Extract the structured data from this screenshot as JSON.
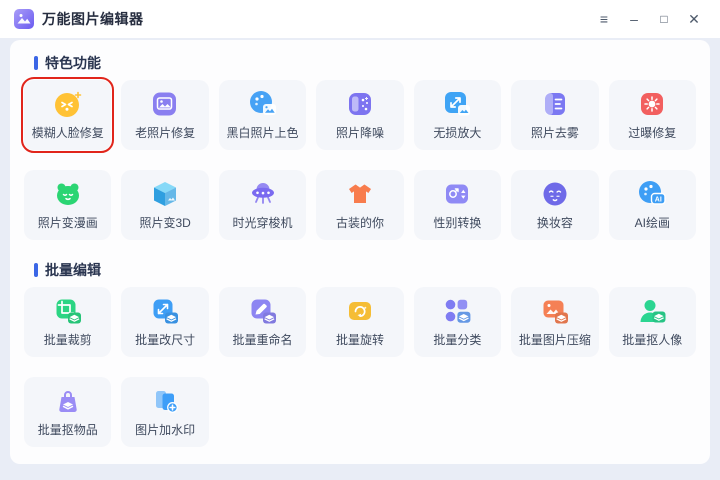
{
  "window": {
    "title": "万能图片编辑器",
    "controls": {
      "menu": "≡",
      "minimize": "–",
      "maximize": "□",
      "close": "✕"
    }
  },
  "colors": {
    "accent": "#3b66e6",
    "highlight_border": "#e1251b",
    "window_bg": "#e9edf6",
    "panel_bg": "#fdfdfe",
    "card_bg": "#f4f6fa"
  },
  "sections": [
    {
      "title": "特色功能",
      "cards": [
        {
          "label": "模糊人脸修复",
          "icon": "blur-face-icon",
          "color": "#ffc235",
          "highlighted": true
        },
        {
          "label": "老照片修复",
          "icon": "old-photo-icon",
          "color": "#8a7ff0"
        },
        {
          "label": "黑白照片上色",
          "icon": "colorize-icon",
          "color": "#47a2f5"
        },
        {
          "label": "照片降噪",
          "icon": "denoise-icon",
          "color": "#7d74f0"
        },
        {
          "label": "无损放大",
          "icon": "enlarge-icon",
          "color": "#3fa4f5"
        },
        {
          "label": "照片去雾",
          "icon": "dehaze-icon",
          "color": "#7b78f2"
        },
        {
          "label": "过曝修复",
          "icon": "overexposure-icon",
          "color": "#f25f5f"
        },
        {
          "label": "照片变漫画",
          "icon": "cartoon-icon",
          "color": "#2bd573"
        },
        {
          "label": "照片变3D",
          "icon": "photo-3d-icon",
          "color": "#2f9fe0"
        },
        {
          "label": "时光穿梭机",
          "icon": "time-machine-icon",
          "color": "#7a6af0"
        },
        {
          "label": "古装的你",
          "icon": "costume-icon",
          "color": "#f87c4d"
        },
        {
          "label": "性别转换",
          "icon": "gender-swap-icon",
          "color": "#8f8af5"
        },
        {
          "label": "换妆容",
          "icon": "makeup-icon",
          "color": "#6f6ae8"
        },
        {
          "label": "AI绘画",
          "icon": "ai-paint-icon",
          "color": "#3e9ef5",
          "badge": "AI"
        }
      ]
    },
    {
      "title": "批量编辑",
      "cards": [
        {
          "label": "批量裁剪",
          "icon": "crop-icon",
          "color": "#2bd583"
        },
        {
          "label": "批量改尺寸",
          "icon": "resize-icon",
          "color": "#3e9ef5"
        },
        {
          "label": "批量重命名",
          "icon": "rename-icon",
          "color": "#8d85f2"
        },
        {
          "label": "批量旋转",
          "icon": "rotate-icon",
          "color": "#f5bd35"
        },
        {
          "label": "批量分类",
          "icon": "classify-icon",
          "color": "#7f7cf2"
        },
        {
          "label": "批量图片压缩",
          "icon": "compress-icon",
          "color": "#f58055"
        },
        {
          "label": "批量抠人像",
          "icon": "portrait-cutout-icon",
          "color": "#2bd591"
        },
        {
          "label": "批量抠物品",
          "icon": "object-cutout-icon",
          "color": "#9a8cf5"
        },
        {
          "label": "图片加水印",
          "icon": "watermark-icon",
          "color": "#3e9ef8"
        }
      ]
    }
  ]
}
